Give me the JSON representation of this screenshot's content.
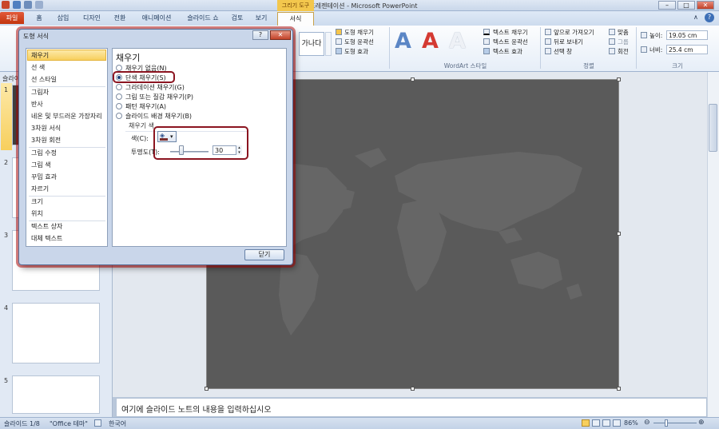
{
  "window": {
    "title": "새 프레젠테이션 - Microsoft PowerPoint",
    "context_tab": "그리기 도구"
  },
  "tabs": [
    {
      "label": "파일"
    },
    {
      "label": "홈"
    },
    {
      "label": "삽입"
    },
    {
      "label": "디자인"
    },
    {
      "label": "전환"
    },
    {
      "label": "애니메이션"
    },
    {
      "label": "슬라이드 쇼"
    },
    {
      "label": "검토"
    },
    {
      "label": "보기"
    },
    {
      "label": "서식"
    }
  ],
  "ribbon": {
    "shape_style_text": "가나다",
    "shape_fill": "도형 채우기",
    "shape_outline": "도형 윤곽선",
    "shape_effects": "도형 효과",
    "wordart_letters": [
      "A",
      "A",
      "A"
    ],
    "text_fill": "텍스트 채우기",
    "text_outline": "텍스트 윤곽선",
    "text_effects": "텍스트 효과",
    "wordart_group": "WordArt 스타일",
    "bring_forward": "앞으로 가져오기",
    "send_backward": "뒤로 보내기",
    "selection_pane": "선택 창",
    "align": "맞춤",
    "group": "그룹",
    "rotate": "회전",
    "arrange_group": "정렬",
    "height_label": "높이:",
    "height_value": "19.05 cm",
    "width_label": "너비:",
    "width_value": "25.4 cm",
    "size_group": "크기"
  },
  "left_panel": {
    "header": "슬라이",
    "slide_numbers": [
      "1",
      "2",
      "3",
      "4",
      "5"
    ]
  },
  "notes": {
    "placeholder": "여기에 슬라이드 노트의 내용을 입력하십시오"
  },
  "status": {
    "slide": "슬라이드 1/8",
    "theme": "\"Office 테마\"",
    "language": "한국어",
    "zoom": "86%"
  },
  "dialog": {
    "title": "도형 서식",
    "help": "?",
    "close": "✕",
    "categories": {
      "a": [
        "채우기",
        "선 색",
        "선 스타일"
      ],
      "b": [
        "그림자",
        "반사",
        "네온 및 부드러운 가장자리",
        "3차원 서식",
        "3차원 회전"
      ],
      "c": [
        "그림 수정",
        "그림 색",
        "꾸밈 효과",
        "자르기"
      ],
      "d": [
        "크기",
        "위치"
      ],
      "e": [
        "텍스트 상자",
        "대체 텍스트"
      ]
    },
    "panel_title": "채우기",
    "options": [
      {
        "label": "채우기 없음(N)",
        "selected": false
      },
      {
        "label": "단색 채우기(S)",
        "selected": true
      },
      {
        "label": "그라데이션 채우기(G)",
        "selected": false
      },
      {
        "label": "그림 또는 질감 채우기(P)",
        "selected": false
      },
      {
        "label": "패턴 채우기(A)",
        "selected": false
      },
      {
        "label": "슬라이드 배경 채우기(B)",
        "selected": false
      }
    ],
    "fill_color_section": "채우기 색",
    "color_label": "색(C):",
    "transparency_label": "투명도(T):",
    "transparency_value": "30",
    "transparency_percent": 30,
    "ok_button": "닫기"
  },
  "colors": {
    "accent_red": "#8b1420",
    "slide_bg": "#5a5a5a",
    "file_tab": "#c3360e"
  }
}
